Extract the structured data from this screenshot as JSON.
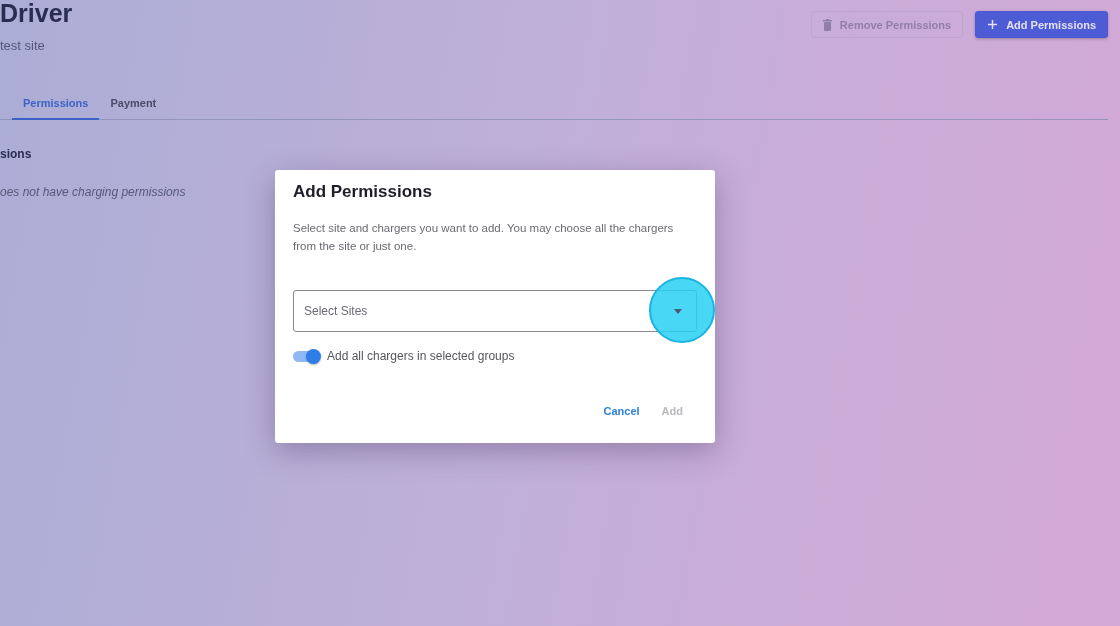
{
  "page": {
    "title": "Driver",
    "subtitle": "test site"
  },
  "actions": [
    {
      "label": "Remove Permissions",
      "kind": "remove",
      "disabled": true
    },
    {
      "label": "Add Permissions",
      "kind": "add",
      "disabled": false
    }
  ],
  "tabs": [
    {
      "label": "Permissions",
      "selected": true
    },
    {
      "label": "Payment",
      "selected": false
    }
  ],
  "section": {
    "title": "sions",
    "empty_text": "oes not have charging permissions"
  },
  "dialog": {
    "title": "Add Permissions",
    "description": "Select site and chargers you want to add. You may choose all the chargers from the site or just one.",
    "select": {
      "placeholder": "Select Sites"
    },
    "toggle": {
      "label": "Add all chargers in selected groups",
      "on": true
    },
    "buttons": [
      {
        "label": "Cancel",
        "disabled": false
      },
      {
        "label": "Add",
        "disabled": true
      }
    ]
  }
}
